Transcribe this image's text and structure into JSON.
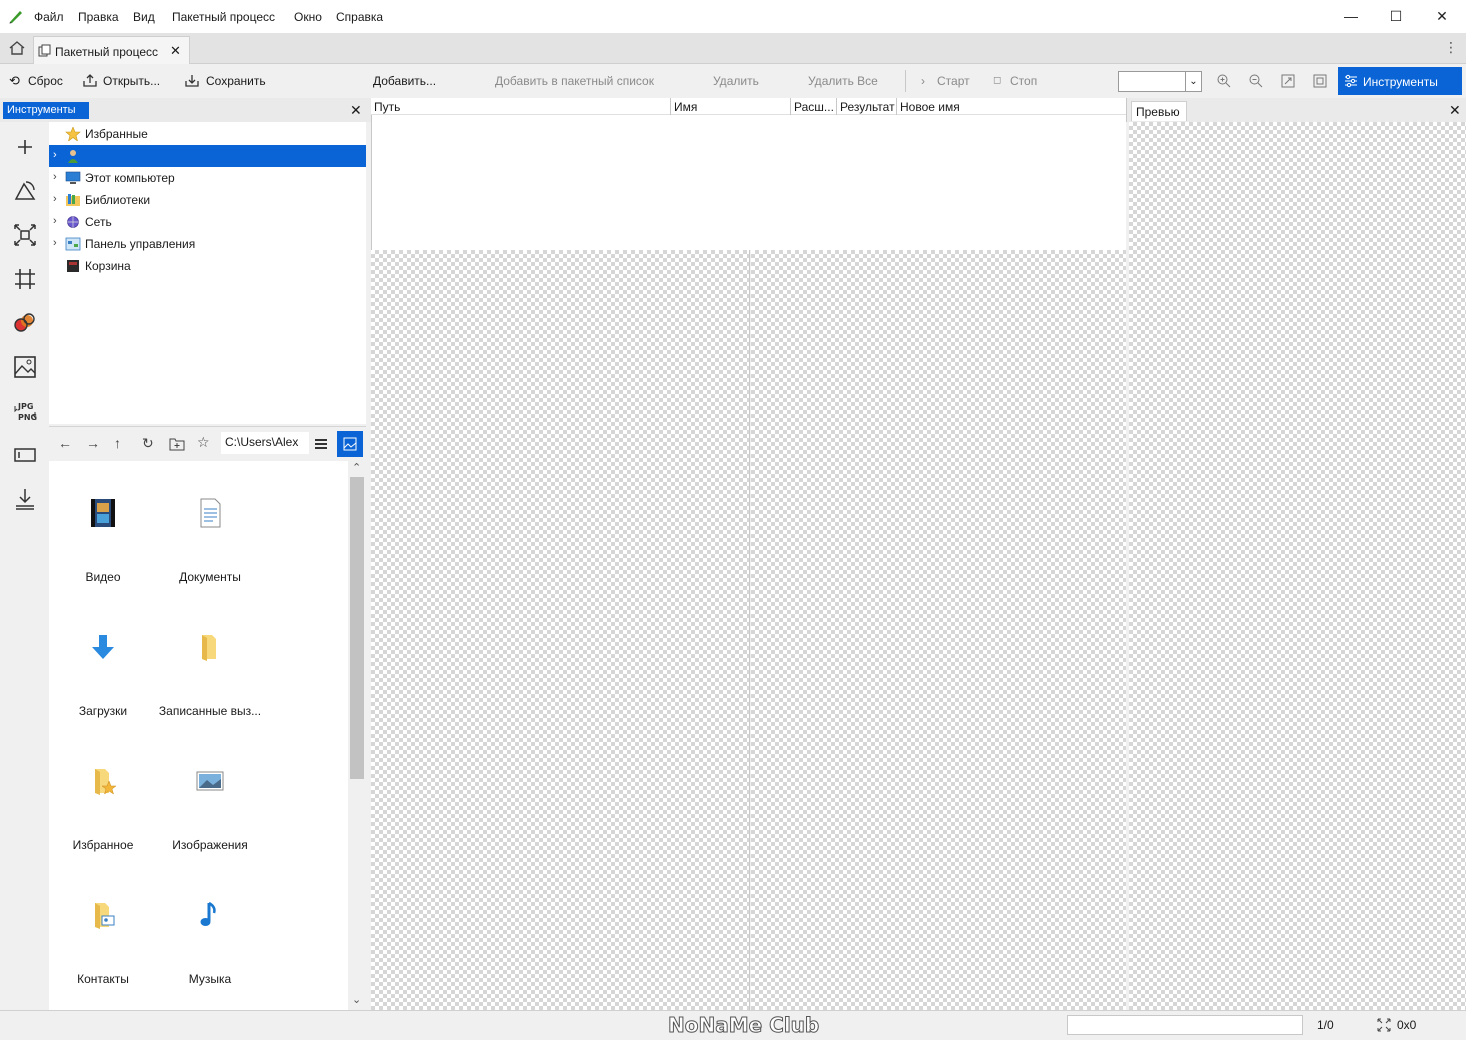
{
  "menu": {
    "items": [
      "Файл",
      "Правка",
      "Вид",
      "Пакетный процесс",
      "Окно",
      "Справка"
    ]
  },
  "window_controls": {
    "minimize": "—",
    "maximize": "☐",
    "close": "✕"
  },
  "tabs": [
    {
      "label": "Пакетный процесс"
    }
  ],
  "toolbar": {
    "reset": "Сброс",
    "open": "Открыть...",
    "save": "Сохранить",
    "add": "Добавить...",
    "add_to_batch": "Добавить в пакетный список",
    "remove": "Удалить",
    "remove_all": "Удалить Все",
    "start": "Старт",
    "stop": "Стоп",
    "zoom_value": "",
    "tools_button": "Инструменты"
  },
  "tools_panel": {
    "title": "Инструменты",
    "tree": [
      {
        "label": "Избранные",
        "expandable": false,
        "selected": false,
        "icon": "star-icon"
      },
      {
        "label": "",
        "expandable": true,
        "selected": true,
        "icon": "user-icon"
      },
      {
        "label": "Этот компьютер",
        "expandable": true,
        "selected": false,
        "icon": "computer-icon"
      },
      {
        "label": "Библиотеки",
        "expandable": true,
        "selected": false,
        "icon": "libraries-icon"
      },
      {
        "label": "Сеть",
        "expandable": true,
        "selected": false,
        "icon": "network-icon"
      },
      {
        "label": "Панель управления",
        "expandable": true,
        "selected": false,
        "icon": "control-panel-icon"
      },
      {
        "label": "Корзина",
        "expandable": false,
        "selected": false,
        "icon": "recycle-bin-icon"
      }
    ],
    "path": "C:\\Users\\Alex",
    "files": [
      {
        "label": "Видео",
        "icon": "video-folder-icon"
      },
      {
        "label": "Документы",
        "icon": "documents-icon"
      },
      {
        "label": "Загрузки",
        "icon": "downloads-icon"
      },
      {
        "label": "Записанные выз...",
        "icon": "folder-icon"
      },
      {
        "label": "Избранное",
        "icon": "favorites-folder-icon"
      },
      {
        "label": "Изображения",
        "icon": "pictures-icon"
      },
      {
        "label": "Контакты",
        "icon": "contacts-icon"
      },
      {
        "label": "Музыка",
        "icon": "music-icon"
      }
    ]
  },
  "batch_list": {
    "columns": [
      "Путь",
      "Имя",
      "Расш...",
      "Результат",
      "Новое имя"
    ]
  },
  "preview_panel": {
    "title": "Превью"
  },
  "status": {
    "watermark": "NoNaMe Club",
    "page": "1/0",
    "size": "0x0"
  },
  "colors": {
    "accent": "#0a64d6",
    "selection": "#0a64d6",
    "menubar": "#ffffff"
  }
}
